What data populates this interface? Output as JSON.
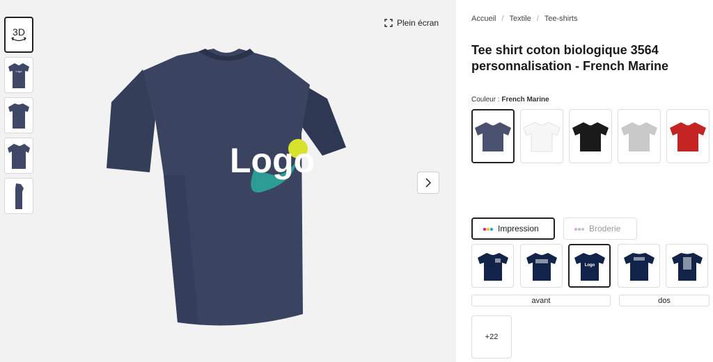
{
  "gallery": {
    "thumbs": [
      {
        "label": "3D",
        "icon": "3d-rotate-icon"
      },
      {
        "icon": "tshirt-front-thumb"
      },
      {
        "icon": "tshirt-back-thumb"
      },
      {
        "icon": "tshirt-angle-thumb"
      },
      {
        "icon": "tshirt-side-thumb"
      }
    ],
    "fullscreen_label": "Plein écran",
    "next_icon": "chevron-right-icon",
    "logo_text": "Logo",
    "shirt_color": "#3a4461"
  },
  "breadcrumb": [
    "Accueil",
    "Textile",
    "Tee-shirts"
  ],
  "product": {
    "title": "Tee shirt coton biologique 3564 personnalisation - French Marine",
    "color_label": "Couleur :",
    "color_value": "French Marine"
  },
  "colors": [
    {
      "name": "French Marine",
      "hex": "#4a5170"
    },
    {
      "name": "Blanc",
      "hex": "#f5f5f5"
    },
    {
      "name": "Noir",
      "hex": "#1a1a1a"
    },
    {
      "name": "Gris",
      "hex": "#c9c9c9"
    },
    {
      "name": "Rouge",
      "hex": "#c42424"
    }
  ],
  "techniques": [
    {
      "label": "Impression",
      "icon": "ink-drops-icon",
      "active": true
    },
    {
      "label": "Broderie",
      "icon": "thread-icon",
      "active": false
    }
  ],
  "placements": {
    "side_labels": [
      "avant",
      "dos"
    ],
    "more_label": "+22"
  }
}
